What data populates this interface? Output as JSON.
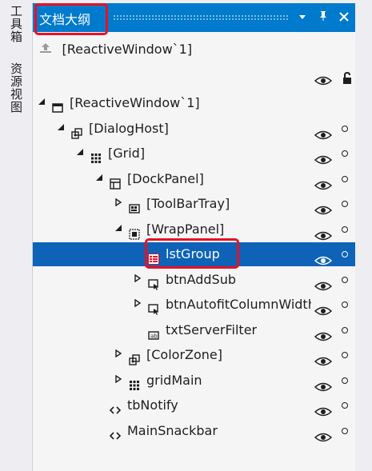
{
  "side_tabs": [
    {
      "label": "工具箱"
    },
    {
      "label": "资源视图"
    }
  ],
  "panel": {
    "title": "文档大纲",
    "buttons": {
      "dropdown_icon": "dropdown-arrow-icon",
      "pin_icon": "pin-icon",
      "close_icon": "close-icon"
    },
    "up_label": "[ReactiveWindow`1]"
  },
  "tree": [
    {
      "label": "[ReactiveWindow`1]",
      "arrow": "expanded",
      "icon": "window-icon",
      "level": 0,
      "visible_toggle": false
    },
    {
      "label": "[DialogHost]",
      "arrow": "expanded",
      "icon": "dialoghost-icon",
      "level": 1,
      "visible_toggle": true
    },
    {
      "label": "[Grid]",
      "arrow": "expanded",
      "icon": "grid-icon",
      "level": 2,
      "visible_toggle": true
    },
    {
      "label": "[DockPanel]",
      "arrow": "expanded",
      "icon": "dockpanel-icon",
      "level": 3,
      "visible_toggle": true
    },
    {
      "label": "[ToolBarTray]",
      "arrow": "collapsed",
      "icon": "toolbartray-icon",
      "level": 4,
      "visible_toggle": true
    },
    {
      "label": "[WrapPanel]",
      "arrow": "expanded",
      "icon": "wrappanel-icon",
      "level": 4,
      "visible_toggle": true
    },
    {
      "label": "lstGroup",
      "arrow": "none",
      "icon": "listbox-icon",
      "level": 5,
      "visible_toggle": true,
      "selected": true
    },
    {
      "label": "btnAddSub",
      "arrow": "collapsed",
      "icon": "button-icon",
      "level": 5,
      "visible_toggle": true
    },
    {
      "label": "btnAutofitColumnWidth",
      "arrow": "collapsed",
      "icon": "button-icon",
      "level": 5,
      "visible_toggle": true
    },
    {
      "label": "txtServerFilter",
      "arrow": "none",
      "icon": "textbox-icon",
      "level": 5,
      "visible_toggle": true
    },
    {
      "label": "[ColorZone]",
      "arrow": "collapsed",
      "icon": "dialoghost-icon",
      "level": 4,
      "visible_toggle": true
    },
    {
      "label": "gridMain",
      "arrow": "collapsed",
      "icon": "grid-icon",
      "level": 4,
      "visible_toggle": true
    },
    {
      "label": "tbNotify",
      "arrow": "none",
      "icon": "code-tag-icon",
      "level": 3,
      "visible_toggle": true
    },
    {
      "label": "MainSnackbar",
      "arrow": "none",
      "icon": "code-tag-icon",
      "level": 3,
      "visible_toggle": true
    }
  ],
  "colors": {
    "accent": "#007acc",
    "selection": "#0e63b8",
    "highlight_box": "#e81123"
  }
}
